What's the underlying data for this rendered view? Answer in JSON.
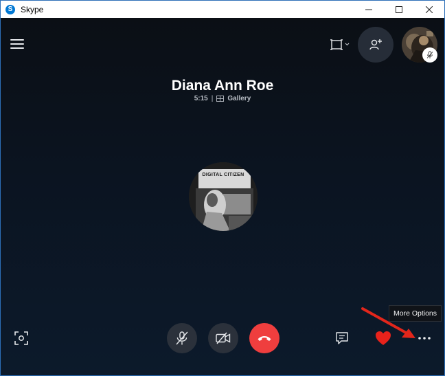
{
  "window": {
    "title": "Skype",
    "app_icon_letter": "S",
    "controls": [
      "minimize-icon",
      "maximize-icon",
      "close-icon"
    ]
  },
  "header": {
    "menu_icon": "hamburger-menu-icon",
    "layout_icon": "screen-layout-icon",
    "add_people_icon": "add-person-icon",
    "self_mute_icon": "microphone-muted-icon"
  },
  "call": {
    "contact_name": "Diana Ann Roe",
    "duration": "5:15",
    "separator": "|",
    "view_mode": "Gallery",
    "view_icon": "gallery-icon",
    "avatar_caption": "DIGITAL CITIZEN"
  },
  "toolbar": {
    "left_icon": "snapshot-icon",
    "mic_icon": "microphone-muted-icon",
    "video_icon": "video-off-icon",
    "hangup_icon": "end-call-icon",
    "chat_icon": "chat-icon",
    "reaction_icon": "heart-icon",
    "more_icon": "more-options-icon",
    "tooltip": "More Options"
  },
  "colors": {
    "hangup": "#ef3e3e",
    "heart": "#e8221b",
    "annotation_arrow": "#e3261b",
    "window_border": "#2d6fb8"
  }
}
